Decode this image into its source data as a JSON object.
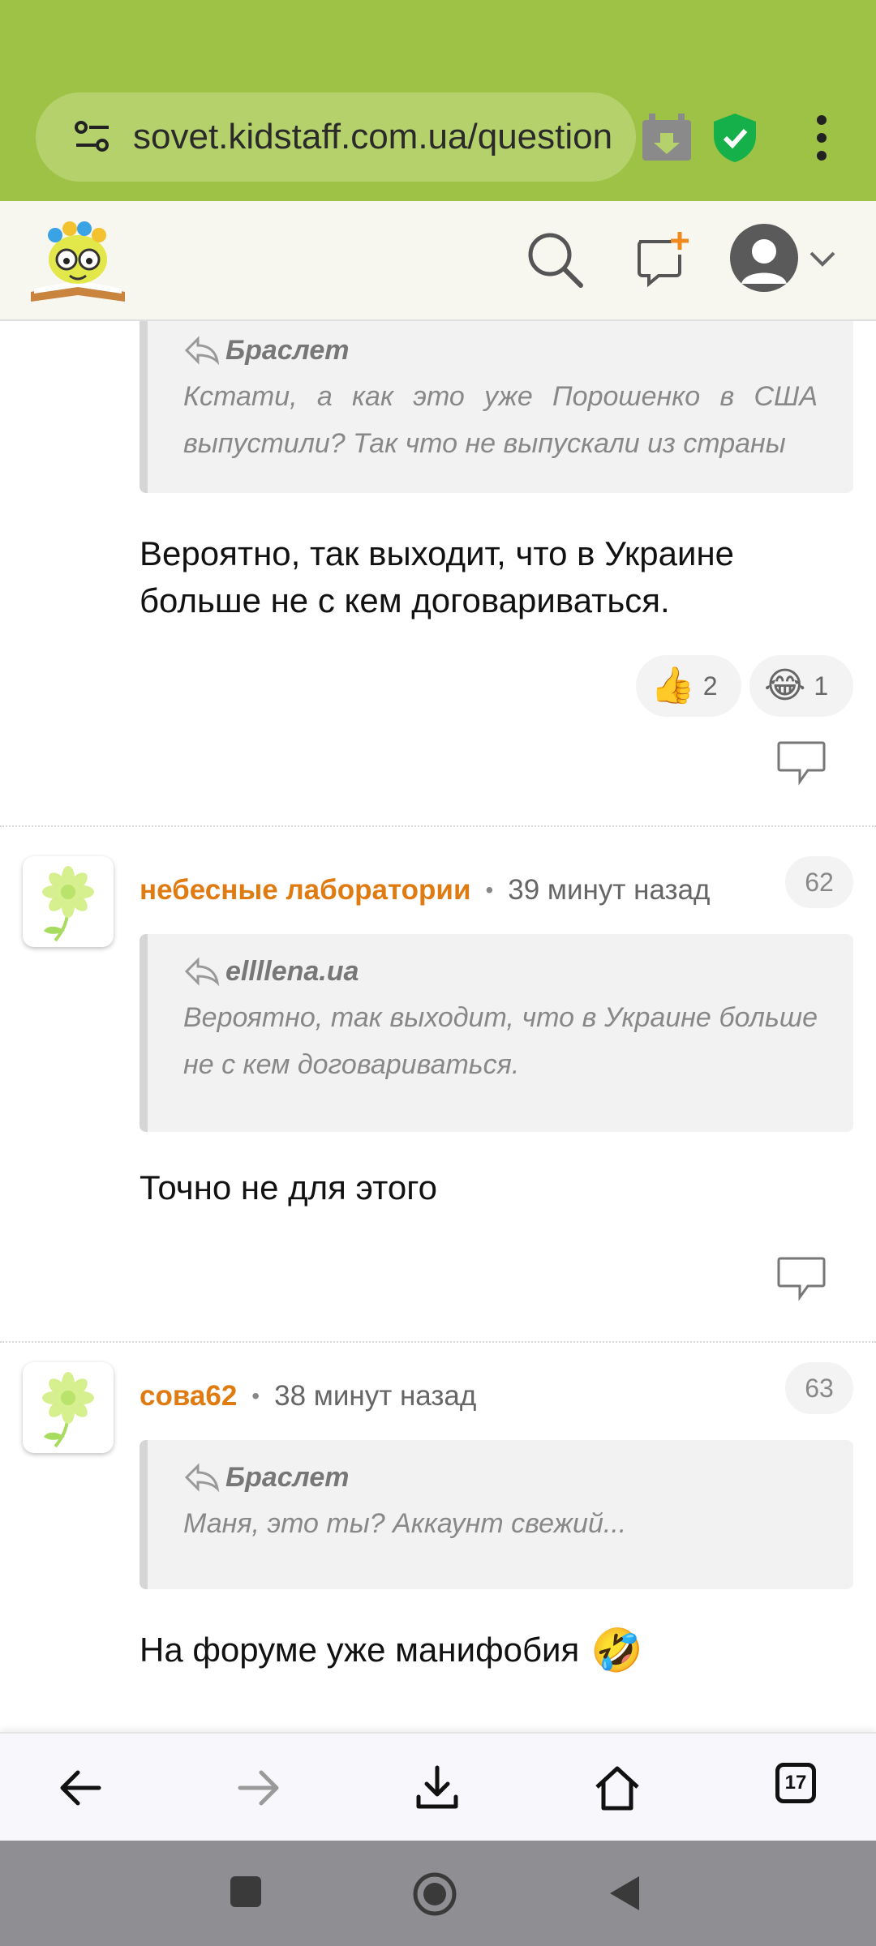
{
  "browser": {
    "url": "sovet.kidstaff.com.ua/question",
    "tab_count": "17"
  },
  "comments": [
    {
      "quote_author": "Браслет",
      "quote_text": "Кстати, а как это уже Порошенко в США выпустили? Так что не выпускали из страны",
      "body_line1": "Вероятно, так выходит, что в Украине",
      "body_line2": "больше не с кем договариваться.",
      "reactions": [
        {
          "emoji": "👍",
          "count": "2"
        },
        {
          "emoji": "😂",
          "count": "1"
        }
      ]
    },
    {
      "username": "небесные лаборатории",
      "dot": "•",
      "time": "39 минут назад",
      "number": "62",
      "quote_author": "ellllena.ua",
      "quote_text": "Вероятно, так выходит, что в Украине больше не с кем договариваться.",
      "body": "Точно не для этого"
    },
    {
      "username": "сова62",
      "dot": "•",
      "time": "38 минут назад",
      "number": "63",
      "quote_author": "Браслет",
      "quote_text": "Маня, это ты? Аккаунт свежий...",
      "body": "На форуме уже манифобия",
      "body_emoji": "🤣"
    }
  ],
  "colors": {
    "browser_bar": "#9dc245",
    "username": "#e07b12"
  },
  "icons": {
    "header": [
      "search-icon",
      "add-comment-icon",
      "user-avatar-icon",
      "chevron-down-icon"
    ],
    "toolbar": [
      "back-arrow-icon",
      "forward-arrow-icon",
      "download-icon",
      "home-icon",
      "tabs-icon"
    ]
  }
}
